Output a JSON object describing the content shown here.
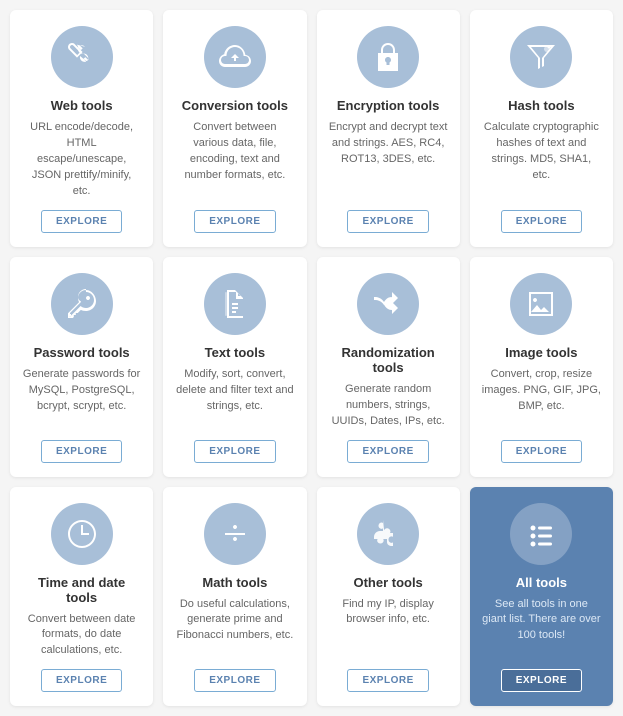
{
  "cards": [
    {
      "id": "web-tools",
      "title": "Web tools",
      "desc": "URL encode/decode, HTML escape/unescape, JSON prettify/minify, etc.",
      "btn": "EXPLORE",
      "icon": "wrench",
      "highlighted": false
    },
    {
      "id": "conversion-tools",
      "title": "Conversion tools",
      "desc": "Convert between various data, file, encoding, text and number formats, etc.",
      "btn": "EXPLORE",
      "icon": "cloud-sync",
      "highlighted": false
    },
    {
      "id": "encryption-tools",
      "title": "Encryption tools",
      "desc": "Encrypt and decrypt text and strings. AES, RC4, ROT13, 3DES, etc.",
      "btn": "EXPLORE",
      "icon": "lock",
      "highlighted": false
    },
    {
      "id": "hash-tools",
      "title": "Hash tools",
      "desc": "Calculate cryptographic hashes of text and strings. MD5, SHA1, etc.",
      "btn": "EXPLORE",
      "icon": "filter",
      "highlighted": false
    },
    {
      "id": "password-tools",
      "title": "Password tools",
      "desc": "Generate passwords for MySQL, PostgreSQL, bcrypt, scrypt, etc.",
      "btn": "EXPLORE",
      "icon": "key",
      "highlighted": false
    },
    {
      "id": "text-tools",
      "title": "Text tools",
      "desc": "Modify, sort, convert, delete and filter text and strings, etc.",
      "btn": "EXPLORE",
      "icon": "document",
      "highlighted": false
    },
    {
      "id": "randomization-tools",
      "title": "Randomization tools",
      "desc": "Generate random numbers, strings, UUIDs, Dates, IPs, etc.",
      "btn": "EXPLORE",
      "icon": "shuffle",
      "highlighted": false
    },
    {
      "id": "image-tools",
      "title": "Image tools",
      "desc": "Convert, crop, resize images. PNG, GIF, JPG, BMP, etc.",
      "btn": "EXPLORE",
      "icon": "image",
      "highlighted": false
    },
    {
      "id": "time-tools",
      "title": "Time and date tools",
      "desc": "Convert between date formats, do date calculations, etc.",
      "btn": "EXPLORE",
      "icon": "clock",
      "highlighted": false
    },
    {
      "id": "math-tools",
      "title": "Math tools",
      "desc": "Do useful calculations, generate prime and Fibonacci numbers, etc.",
      "btn": "EXPLORE",
      "icon": "divide",
      "highlighted": false
    },
    {
      "id": "other-tools",
      "title": "Other tools",
      "desc": "Find my IP, display browser info, etc.",
      "btn": "EXPLORE",
      "icon": "puzzle",
      "highlighted": false
    },
    {
      "id": "all-tools",
      "title": "All tools",
      "desc": "See all tools in one giant list. There are over 100 tools!",
      "btn": "EXPLORE",
      "icon": "list",
      "highlighted": true
    }
  ]
}
